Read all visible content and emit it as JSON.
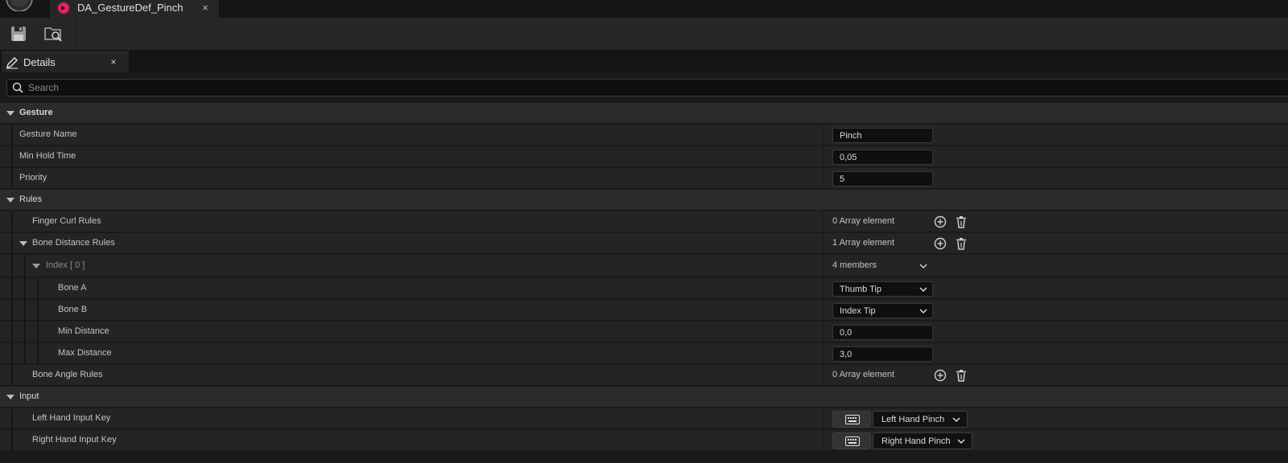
{
  "colors": {
    "accent": "#e0245e",
    "background": "#151515",
    "panel": "#1a1a1a",
    "row": "#242424",
    "category_row": "#2b2b2b"
  },
  "titlebar": {
    "app_logo_icon": "unreal-logo-icon",
    "tab": {
      "icon": "data-asset-icon",
      "label": "DA_GestureDef_Pinch",
      "close": "×"
    }
  },
  "toolbar": {
    "save_icon": "save-icon",
    "browse_icon": "browse-to-asset-icon"
  },
  "details_tab": {
    "icon": "details-pencil-icon",
    "label": "Details",
    "close": "×"
  },
  "search": {
    "placeholder": "Search",
    "value": ""
  },
  "categories": {
    "gesture": {
      "label": "Gesture",
      "gesture_name": {
        "label": "Gesture Name",
        "value": "Pinch"
      },
      "min_hold_time": {
        "label": "Min Hold Time",
        "value": "0,05"
      },
      "priority": {
        "label": "Priority",
        "value": "5"
      }
    },
    "rules": {
      "label": "Rules",
      "finger_curl_rules": {
        "label": "Finger Curl Rules",
        "value": "0 Array element"
      },
      "bone_distance_rules": {
        "label": "Bone Distance Rules",
        "value": "1 Array element",
        "index0": {
          "label": "Index [ 0 ]",
          "value": "4 members",
          "bone_a": {
            "label": "Bone A",
            "value": "Thumb Tip"
          },
          "bone_b": {
            "label": "Bone B",
            "value": "Index Tip"
          },
          "min_distance": {
            "label": "Min Distance",
            "value": "0,0"
          },
          "max_distance": {
            "label": "Max Distance",
            "value": "3,0"
          }
        }
      },
      "bone_angle_rules": {
        "label": "Bone Angle Rules",
        "value": "0 Array element"
      }
    },
    "input": {
      "label": "Input",
      "left_hand_input_key": {
        "label": "Left Hand Input Key",
        "value": "Left Hand Pinch"
      },
      "right_hand_input_key": {
        "label": "Right Hand Input Key",
        "value": "Right Hand Pinch"
      }
    }
  }
}
